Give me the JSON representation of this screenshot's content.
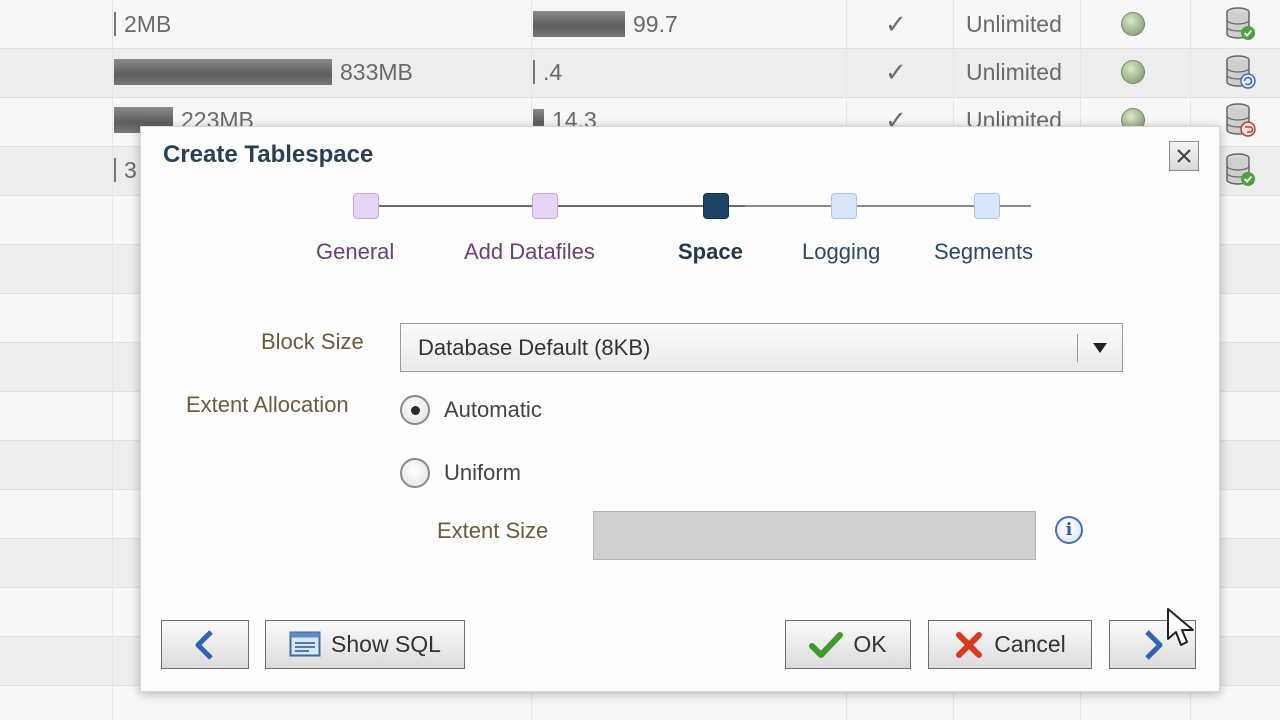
{
  "background_table": {
    "rows": [
      {
        "size_label": "2MB",
        "size_fill": 0.0,
        "used_label": "99.7",
        "used_fill": 0.997,
        "auto_extend": true,
        "max_size": "Unlimited",
        "status": "online",
        "icon": "database-check-icon"
      },
      {
        "size_label": "833MB",
        "size_fill": 1.0,
        "used_label": ".4",
        "used_fill": 0.004,
        "auto_extend": true,
        "max_size": "Unlimited",
        "status": "online",
        "icon": "database-refresh-icon"
      },
      {
        "size_label": "223MB",
        "size_fill": 0.27,
        "used_label": "14.3",
        "used_fill": 0.143,
        "auto_extend": true,
        "max_size": "Unlimited",
        "status": "online",
        "icon": "database-undo-icon"
      },
      {
        "size_label": "3",
        "size_fill": 0.0,
        "icon": "database-check-icon"
      }
    ]
  },
  "dialog": {
    "title": "Create Tablespace",
    "close_icon": "close-icon",
    "train": {
      "steps": [
        {
          "label": "General",
          "state": "visited"
        },
        {
          "label": "Add Datafiles",
          "state": "visited"
        },
        {
          "label": "Space",
          "state": "current"
        },
        {
          "label": "Logging",
          "state": "unvisited"
        },
        {
          "label": "Segments",
          "state": "unvisited"
        }
      ]
    },
    "form": {
      "block_size_label": "Block Size",
      "block_size_value": "Database Default (8KB)",
      "extent_allocation_label": "Extent Allocation",
      "options": [
        {
          "label": "Automatic",
          "selected": true
        },
        {
          "label": "Uniform",
          "selected": false
        }
      ],
      "extent_size_label": "Extent Size",
      "extent_size_value": ""
    },
    "buttons": {
      "back_icon": "chevron-left-icon",
      "show_sql": "Show SQL",
      "ok": "OK",
      "cancel": "Cancel",
      "next_icon": "chevron-right-icon"
    }
  },
  "colors": {
    "title": "#2a3f55",
    "step_visited": "#e7d4f3",
    "step_current": "#1f4566",
    "step_unvisited": "#d7e6fa",
    "label": "#6b5a3c",
    "ok_green": "#3f9a2c",
    "cancel_red": "#d93a1f"
  }
}
